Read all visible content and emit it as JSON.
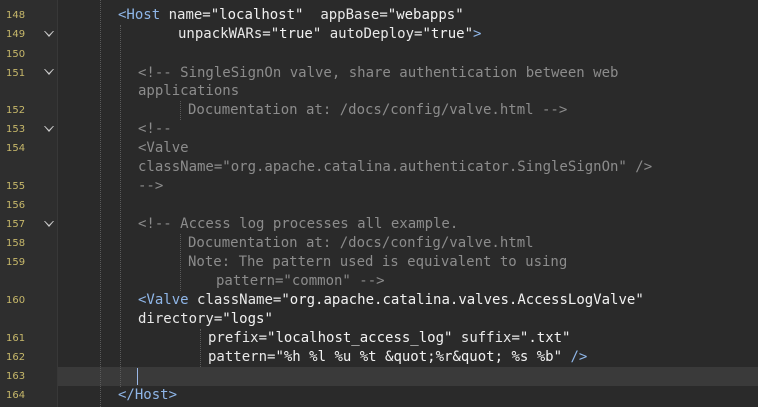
{
  "editor": {
    "line_numbers": [
      "148",
      "149",
      "150",
      "151",
      "152",
      "153",
      "154",
      "155",
      "156",
      "157",
      "158",
      "159",
      "160",
      "161",
      "162",
      "163",
      "164"
    ],
    "lines": {
      "l148": {
        "open": "<Host",
        "a1": "name=",
        "v1": "\"localhost\"",
        "a2": "appBase=",
        "v2": "\"webapps\""
      },
      "l149": {
        "a1": "unpackWARs=",
        "v1": "\"true\"",
        "a2": "autoDeploy=",
        "v2": "\"true\"",
        "close": ">"
      },
      "l151a": "<!-- SingleSignOn valve, share authentication between web",
      "l151b": "applications",
      "l152": "Documentation at: /docs/config/valve.html -->",
      "l153": "<!--",
      "l154a": "<Valve",
      "l154b": "className=\"org.apache.catalina.authenticator.SingleSignOn\" />",
      "l155": "-->",
      "l157": "<!-- Access log processes all example.",
      "l158": "Documentation at: /docs/config/valve.html",
      "l159a": "Note: The pattern used is equivalent to using",
      "l159b": "pattern=\"common\" -->",
      "l160": {
        "open": "<Valve",
        "a1": "className=",
        "v1": "\"org.apache.catalina.valves.AccessLogValve\"",
        "a2": "directory=",
        "v2": "\"logs\""
      },
      "l161": {
        "a1": "prefix=",
        "v1": "\"localhost_access_log\"",
        "a2": "suffix=",
        "v2": "\".txt\""
      },
      "l162": {
        "a1": "pattern=",
        "v1": "\"%h %l %u %t &quot;%r&quot; %s %b\"",
        "close": "/>"
      },
      "l164": "</Host>"
    }
  },
  "colors": {
    "background": "#2a2a2a",
    "gutter": "#2e2e2e",
    "line_number": "#c7b86a",
    "tag": "#8fb6e8",
    "comment": "#8c8c8c",
    "current_line": "#3a3a3a"
  },
  "icons": [
    "fold-triangle-icon"
  ]
}
